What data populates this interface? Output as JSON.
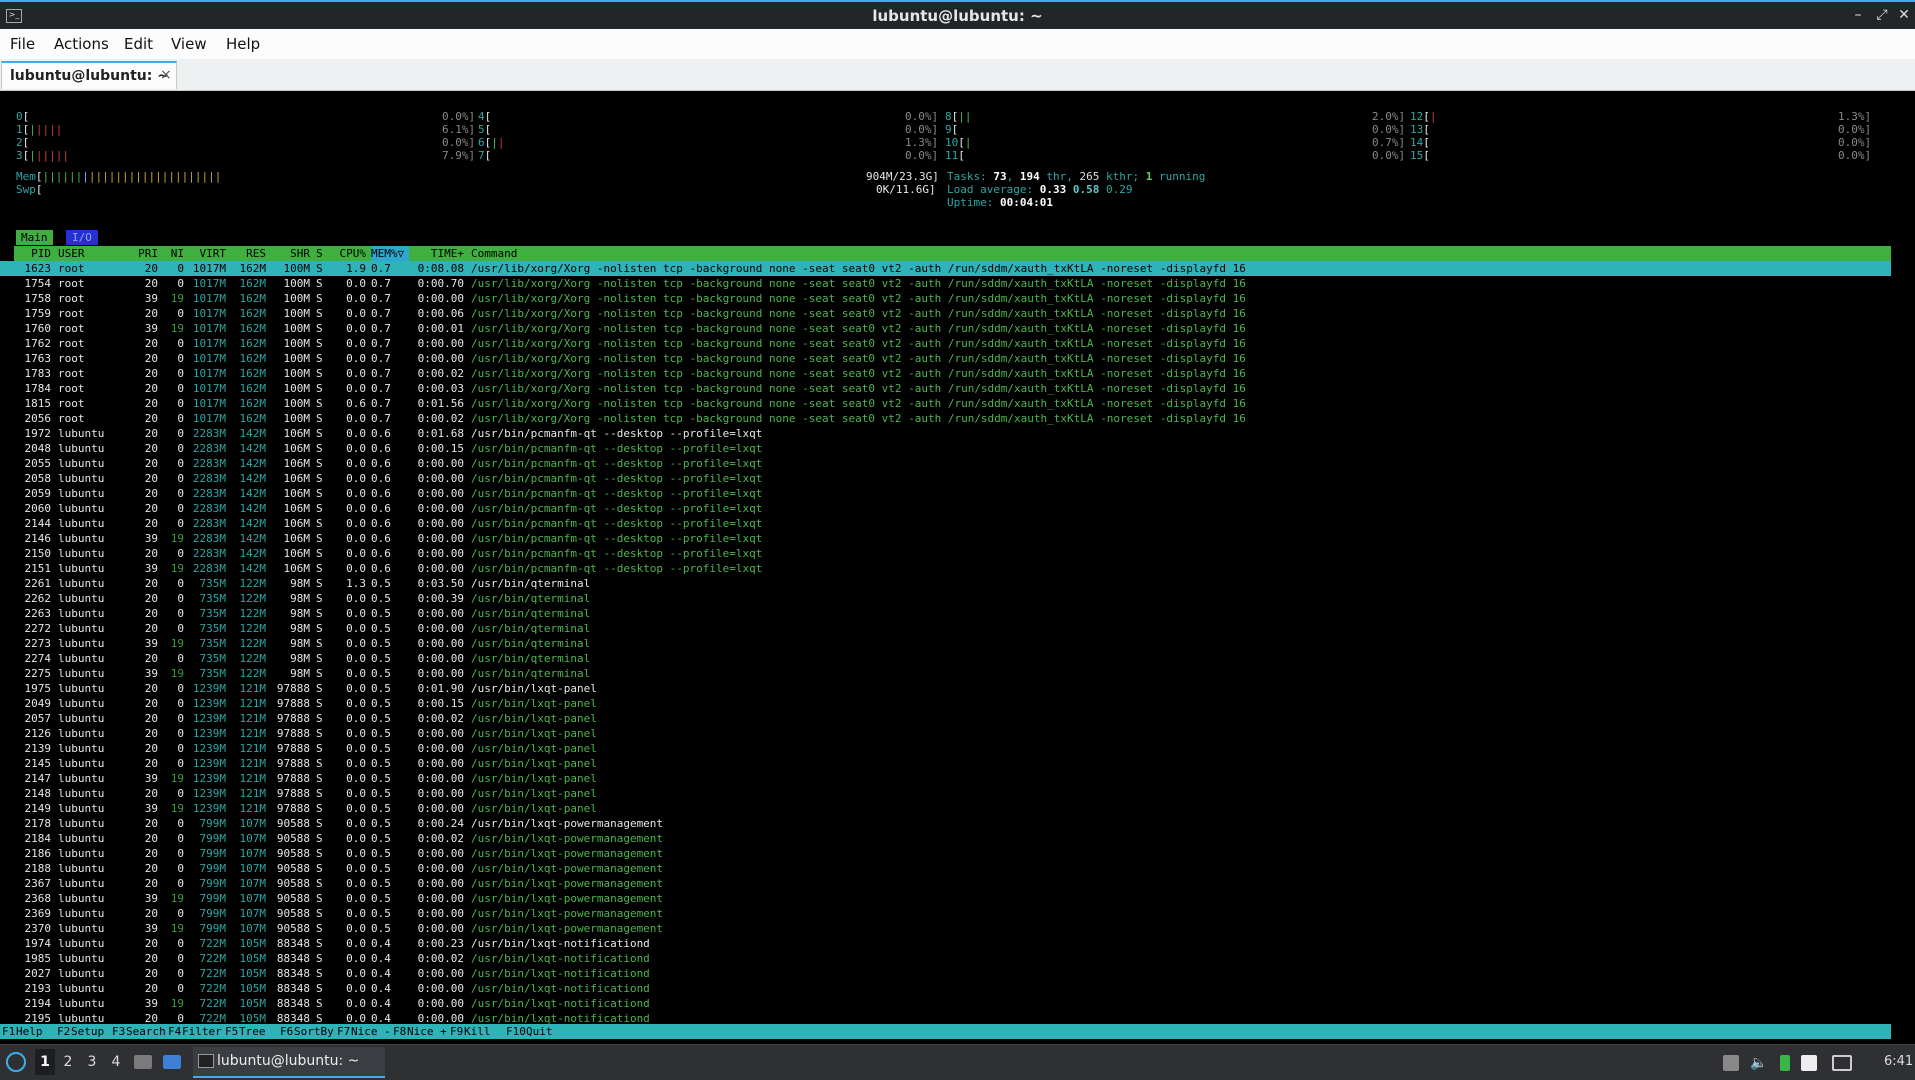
{
  "window": {
    "title": "lubuntu@lubuntu: ~",
    "app_icon": "terminal-icon"
  },
  "menubar": [
    "File",
    "Actions",
    "Edit",
    "View",
    "Help"
  ],
  "tab": {
    "label": "lubuntu@lubuntu: ~",
    "close": "×"
  },
  "cpu_meters": [
    {
      "id": "0",
      "val": "0.0%]",
      "bar": "",
      "bar2": ""
    },
    {
      "id": "1",
      "val": "6.1%]",
      "bar": "|",
      "bar2": "||||"
    },
    {
      "id": "2",
      "val": "0.0%]",
      "bar": "",
      "bar2": ""
    },
    {
      "id": "3",
      "val": "7.9%]",
      "bar": "|",
      "bar2": "|||||"
    },
    {
      "id": "4",
      "val": "0.0%]",
      "bar": "",
      "bar2": ""
    },
    {
      "id": "5",
      "val": "0.0%]",
      "bar": "",
      "bar2": ""
    },
    {
      "id": "6",
      "val": "1.3%]",
      "bar": "|",
      "bar2": "|"
    },
    {
      "id": "7",
      "val": "0.0%]",
      "bar": "",
      "bar2": ""
    },
    {
      "id": "8",
      "val": "2.0%]",
      "bar": "||",
      "bar2": ""
    },
    {
      "id": "9",
      "val": "0.0%]",
      "bar": "",
      "bar2": ""
    },
    {
      "id": "10",
      "val": "0.7%]",
      "bar": "|",
      "bar2": ""
    },
    {
      "id": "11",
      "val": "0.0%]",
      "bar": "",
      "bar2": ""
    },
    {
      "id": "12",
      "val": "1.3%]",
      "bar": "",
      "bar2": "|"
    },
    {
      "id": "13",
      "val": "0.0%]",
      "bar": "",
      "bar2": ""
    },
    {
      "id": "14",
      "val": "0.0%]",
      "bar": "",
      "bar2": ""
    },
    {
      "id": "15",
      "val": "0.0%]",
      "bar": "",
      "bar2": ""
    }
  ],
  "mem": {
    "label": "Mem",
    "bar": "||||||",
    "bar_blue": "|",
    "bar_yellow": "||||||||||||||||||||",
    "value": "904M/23.3G]"
  },
  "swp": {
    "label": "Swp",
    "value": "0K/11.6G]"
  },
  "tasks": {
    "label": "Tasks:",
    "count": "73",
    "thr": "194",
    "thr_label": "thr,",
    "kthr": "265",
    "kthr_label": "kthr;",
    "running": "1",
    "running_label": "running"
  },
  "load": {
    "label": "Load average:",
    "v1": "0.33",
    "v2": "0.58",
    "v3": "0.29"
  },
  "uptime": {
    "label": "Uptime:",
    "value": "00:04:01"
  },
  "tabs": {
    "main": "Main",
    "io": "I/O"
  },
  "columns": [
    "PID",
    "USER",
    "PRI",
    "NI",
    "VIRT",
    "RES",
    "SHR",
    "S",
    "CPU%",
    "MEM%▽",
    "TIME+",
    "Command"
  ],
  "processes": [
    [
      "1623",
      "root",
      "20",
      "0",
      "1017M",
      "162M",
      "100M",
      "S",
      "1.9",
      "0.7",
      "0:08.08",
      "/usr/lib/xorg/Xorg -nolisten tcp -background none -seat seat0 vt2 -auth /run/sddm/xauth_txKtLA -noreset -displayfd 16"
    ],
    [
      "1754",
      "root",
      "20",
      "0",
      "1017M",
      "162M",
      "100M",
      "S",
      "0.0",
      "0.7",
      "0:00.70",
      "/usr/lib/xorg/Xorg -nolisten tcp -background none -seat seat0 vt2 -auth /run/sddm/xauth_txKtLA -noreset -displayfd 16"
    ],
    [
      "1758",
      "root",
      "39",
      "19",
      "1017M",
      "162M",
      "100M",
      "S",
      "0.0",
      "0.7",
      "0:00.00",
      "/usr/lib/xorg/Xorg -nolisten tcp -background none -seat seat0 vt2 -auth /run/sddm/xauth_txKtLA -noreset -displayfd 16"
    ],
    [
      "1759",
      "root",
      "20",
      "0",
      "1017M",
      "162M",
      "100M",
      "S",
      "0.0",
      "0.7",
      "0:00.06",
      "/usr/lib/xorg/Xorg -nolisten tcp -background none -seat seat0 vt2 -auth /run/sddm/xauth_txKtLA -noreset -displayfd 16"
    ],
    [
      "1760",
      "root",
      "39",
      "19",
      "1017M",
      "162M",
      "100M",
      "S",
      "0.0",
      "0.7",
      "0:00.01",
      "/usr/lib/xorg/Xorg -nolisten tcp -background none -seat seat0 vt2 -auth /run/sddm/xauth_txKtLA -noreset -displayfd 16"
    ],
    [
      "1762",
      "root",
      "20",
      "0",
      "1017M",
      "162M",
      "100M",
      "S",
      "0.0",
      "0.7",
      "0:00.00",
      "/usr/lib/xorg/Xorg -nolisten tcp -background none -seat seat0 vt2 -auth /run/sddm/xauth_txKtLA -noreset -displayfd 16"
    ],
    [
      "1763",
      "root",
      "20",
      "0",
      "1017M",
      "162M",
      "100M",
      "S",
      "0.0",
      "0.7",
      "0:00.00",
      "/usr/lib/xorg/Xorg -nolisten tcp -background none -seat seat0 vt2 -auth /run/sddm/xauth_txKtLA -noreset -displayfd 16"
    ],
    [
      "1783",
      "root",
      "20",
      "0",
      "1017M",
      "162M",
      "100M",
      "S",
      "0.0",
      "0.7",
      "0:00.02",
      "/usr/lib/xorg/Xorg -nolisten tcp -background none -seat seat0 vt2 -auth /run/sddm/xauth_txKtLA -noreset -displayfd 16"
    ],
    [
      "1784",
      "root",
      "20",
      "0",
      "1017M",
      "162M",
      "100M",
      "S",
      "0.0",
      "0.7",
      "0:00.03",
      "/usr/lib/xorg/Xorg -nolisten tcp -background none -seat seat0 vt2 -auth /run/sddm/xauth_txKtLA -noreset -displayfd 16"
    ],
    [
      "1815",
      "root",
      "20",
      "0",
      "1017M",
      "162M",
      "100M",
      "S",
      "0.6",
      "0.7",
      "0:01.56",
      "/usr/lib/xorg/Xorg -nolisten tcp -background none -seat seat0 vt2 -auth /run/sddm/xauth_txKtLA -noreset -displayfd 16"
    ],
    [
      "2056",
      "root",
      "20",
      "0",
      "1017M",
      "162M",
      "100M",
      "S",
      "0.0",
      "0.7",
      "0:00.02",
      "/usr/lib/xorg/Xorg -nolisten tcp -background none -seat seat0 vt2 -auth /run/sddm/xauth_txKtLA -noreset -displayfd 16"
    ],
    [
      "1972",
      "lubuntu",
      "20",
      "0",
      "2283M",
      "142M",
      "106M",
      "S",
      "0.0",
      "0.6",
      "0:01.68",
      "/usr/bin/pcmanfm-qt --desktop --profile=lxqt"
    ],
    [
      "2048",
      "lubuntu",
      "20",
      "0",
      "2283M",
      "142M",
      "106M",
      "S",
      "0.0",
      "0.6",
      "0:00.15",
      "/usr/bin/pcmanfm-qt --desktop --profile=lxqt"
    ],
    [
      "2055",
      "lubuntu",
      "20",
      "0",
      "2283M",
      "142M",
      "106M",
      "S",
      "0.0",
      "0.6",
      "0:00.00",
      "/usr/bin/pcmanfm-qt --desktop --profile=lxqt"
    ],
    [
      "2058",
      "lubuntu",
      "20",
      "0",
      "2283M",
      "142M",
      "106M",
      "S",
      "0.0",
      "0.6",
      "0:00.00",
      "/usr/bin/pcmanfm-qt --desktop --profile=lxqt"
    ],
    [
      "2059",
      "lubuntu",
      "20",
      "0",
      "2283M",
      "142M",
      "106M",
      "S",
      "0.0",
      "0.6",
      "0:00.00",
      "/usr/bin/pcmanfm-qt --desktop --profile=lxqt"
    ],
    [
      "2060",
      "lubuntu",
      "20",
      "0",
      "2283M",
      "142M",
      "106M",
      "S",
      "0.0",
      "0.6",
      "0:00.00",
      "/usr/bin/pcmanfm-qt --desktop --profile=lxqt"
    ],
    [
      "2144",
      "lubuntu",
      "20",
      "0",
      "2283M",
      "142M",
      "106M",
      "S",
      "0.0",
      "0.6",
      "0:00.00",
      "/usr/bin/pcmanfm-qt --desktop --profile=lxqt"
    ],
    [
      "2146",
      "lubuntu",
      "39",
      "19",
      "2283M",
      "142M",
      "106M",
      "S",
      "0.0",
      "0.6",
      "0:00.00",
      "/usr/bin/pcmanfm-qt --desktop --profile=lxqt"
    ],
    [
      "2150",
      "lubuntu",
      "20",
      "0",
      "2283M",
      "142M",
      "106M",
      "S",
      "0.0",
      "0.6",
      "0:00.00",
      "/usr/bin/pcmanfm-qt --desktop --profile=lxqt"
    ],
    [
      "2151",
      "lubuntu",
      "39",
      "19",
      "2283M",
      "142M",
      "106M",
      "S",
      "0.0",
      "0.6",
      "0:00.00",
      "/usr/bin/pcmanfm-qt --desktop --profile=lxqt"
    ],
    [
      "2261",
      "lubuntu",
      "20",
      "0",
      "735M",
      "122M",
      "98M",
      "S",
      "1.3",
      "0.5",
      "0:03.50",
      "/usr/bin/qterminal"
    ],
    [
      "2262",
      "lubuntu",
      "20",
      "0",
      "735M",
      "122M",
      "98M",
      "S",
      "0.0",
      "0.5",
      "0:00.39",
      "/usr/bin/qterminal"
    ],
    [
      "2263",
      "lubuntu",
      "20",
      "0",
      "735M",
      "122M",
      "98M",
      "S",
      "0.0",
      "0.5",
      "0:00.00",
      "/usr/bin/qterminal"
    ],
    [
      "2272",
      "lubuntu",
      "20",
      "0",
      "735M",
      "122M",
      "98M",
      "S",
      "0.0",
      "0.5",
      "0:00.00",
      "/usr/bin/qterminal"
    ],
    [
      "2273",
      "lubuntu",
      "39",
      "19",
      "735M",
      "122M",
      "98M",
      "S",
      "0.0",
      "0.5",
      "0:00.00",
      "/usr/bin/qterminal"
    ],
    [
      "2274",
      "lubuntu",
      "20",
      "0",
      "735M",
      "122M",
      "98M",
      "S",
      "0.0",
      "0.5",
      "0:00.00",
      "/usr/bin/qterminal"
    ],
    [
      "2275",
      "lubuntu",
      "39",
      "19",
      "735M",
      "122M",
      "98M",
      "S",
      "0.0",
      "0.5",
      "0:00.00",
      "/usr/bin/qterminal"
    ],
    [
      "1975",
      "lubuntu",
      "20",
      "0",
      "1239M",
      "121M",
      "97888",
      "S",
      "0.0",
      "0.5",
      "0:01.90",
      "/usr/bin/lxqt-panel"
    ],
    [
      "2049",
      "lubuntu",
      "20",
      "0",
      "1239M",
      "121M",
      "97888",
      "S",
      "0.0",
      "0.5",
      "0:00.15",
      "/usr/bin/lxqt-panel"
    ],
    [
      "2057",
      "lubuntu",
      "20",
      "0",
      "1239M",
      "121M",
      "97888",
      "S",
      "0.0",
      "0.5",
      "0:00.02",
      "/usr/bin/lxqt-panel"
    ],
    [
      "2126",
      "lubuntu",
      "20",
      "0",
      "1239M",
      "121M",
      "97888",
      "S",
      "0.0",
      "0.5",
      "0:00.00",
      "/usr/bin/lxqt-panel"
    ],
    [
      "2139",
      "lubuntu",
      "20",
      "0",
      "1239M",
      "121M",
      "97888",
      "S",
      "0.0",
      "0.5",
      "0:00.00",
      "/usr/bin/lxqt-panel"
    ],
    [
      "2145",
      "lubuntu",
      "20",
      "0",
      "1239M",
      "121M",
      "97888",
      "S",
      "0.0",
      "0.5",
      "0:00.00",
      "/usr/bin/lxqt-panel"
    ],
    [
      "2147",
      "lubuntu",
      "39",
      "19",
      "1239M",
      "121M",
      "97888",
      "S",
      "0.0",
      "0.5",
      "0:00.00",
      "/usr/bin/lxqt-panel"
    ],
    [
      "2148",
      "lubuntu",
      "20",
      "0",
      "1239M",
      "121M",
      "97888",
      "S",
      "0.0",
      "0.5",
      "0:00.00",
      "/usr/bin/lxqt-panel"
    ],
    [
      "2149",
      "lubuntu",
      "39",
      "19",
      "1239M",
      "121M",
      "97888",
      "S",
      "0.0",
      "0.5",
      "0:00.00",
      "/usr/bin/lxqt-panel"
    ],
    [
      "2178",
      "lubuntu",
      "20",
      "0",
      "799M",
      "107M",
      "90588",
      "S",
      "0.0",
      "0.5",
      "0:00.24",
      "/usr/bin/lxqt-powermanagement"
    ],
    [
      "2184",
      "lubuntu",
      "20",
      "0",
      "799M",
      "107M",
      "90588",
      "S",
      "0.0",
      "0.5",
      "0:00.02",
      "/usr/bin/lxqt-powermanagement"
    ],
    [
      "2186",
      "lubuntu",
      "20",
      "0",
      "799M",
      "107M",
      "90588",
      "S",
      "0.0",
      "0.5",
      "0:00.00",
      "/usr/bin/lxqt-powermanagement"
    ],
    [
      "2188",
      "lubuntu",
      "20",
      "0",
      "799M",
      "107M",
      "90588",
      "S",
      "0.0",
      "0.5",
      "0:00.00",
      "/usr/bin/lxqt-powermanagement"
    ],
    [
      "2367",
      "lubuntu",
      "20",
      "0",
      "799M",
      "107M",
      "90588",
      "S",
      "0.0",
      "0.5",
      "0:00.00",
      "/usr/bin/lxqt-powermanagement"
    ],
    [
      "2368",
      "lubuntu",
      "39",
      "19",
      "799M",
      "107M",
      "90588",
      "S",
      "0.0",
      "0.5",
      "0:00.00",
      "/usr/bin/lxqt-powermanagement"
    ],
    [
      "2369",
      "lubuntu",
      "20",
      "0",
      "799M",
      "107M",
      "90588",
      "S",
      "0.0",
      "0.5",
      "0:00.00",
      "/usr/bin/lxqt-powermanagement"
    ],
    [
      "2370",
      "lubuntu",
      "39",
      "19",
      "799M",
      "107M",
      "90588",
      "S",
      "0.0",
      "0.5",
      "0:00.00",
      "/usr/bin/lxqt-powermanagement"
    ],
    [
      "1974",
      "lubuntu",
      "20",
      "0",
      "722M",
      "105M",
      "88348",
      "S",
      "0.0",
      "0.4",
      "0:00.23",
      "/usr/bin/lxqt-notificationd"
    ],
    [
      "1985",
      "lubuntu",
      "20",
      "0",
      "722M",
      "105M",
      "88348",
      "S",
      "0.0",
      "0.4",
      "0:00.02",
      "/usr/bin/lxqt-notificationd"
    ],
    [
      "2027",
      "lubuntu",
      "20",
      "0",
      "722M",
      "105M",
      "88348",
      "S",
      "0.0",
      "0.4",
      "0:00.00",
      "/usr/bin/lxqt-notificationd"
    ],
    [
      "2193",
      "lubuntu",
      "20",
      "0",
      "722M",
      "105M",
      "88348",
      "S",
      "0.0",
      "0.4",
      "0:00.00",
      "/usr/bin/lxqt-notificationd"
    ],
    [
      "2194",
      "lubuntu",
      "39",
      "19",
      "722M",
      "105M",
      "88348",
      "S",
      "0.0",
      "0.4",
      "0:00.00",
      "/usr/bin/lxqt-notificationd"
    ],
    [
      "2195",
      "lubuntu",
      "20",
      "0",
      "722M",
      "105M",
      "88348",
      "S",
      "0.0",
      "0.4",
      "0:00.00",
      "/usr/bin/lxqt-notificationd"
    ]
  ],
  "fkeys": [
    {
      "k": "F1",
      "l": "Help  "
    },
    {
      "k": "F2",
      "l": "Setup "
    },
    {
      "k": "F3",
      "l": "Search"
    },
    {
      "k": "F4",
      "l": "Filter"
    },
    {
      "k": "F5",
      "l": "Tree  "
    },
    {
      "k": "F6",
      "l": "SortBy"
    },
    {
      "k": "F7",
      "l": "Nice -"
    },
    {
      "k": "F8",
      "l": "Nice +"
    },
    {
      "k": "F9",
      "l": "Kill  "
    },
    {
      "k": "F10",
      "l": "Quit  "
    }
  ],
  "taskbar": {
    "workspaces": [
      "1",
      "2",
      "3",
      "4"
    ],
    "active_workspace": "1",
    "window_label": "lubuntu@lubuntu: ~",
    "clock": "6:41"
  },
  "colors": {
    "accent": "#3daee9",
    "header_green": "#3fb03f",
    "selected_cyan": "#2eb3b8"
  }
}
